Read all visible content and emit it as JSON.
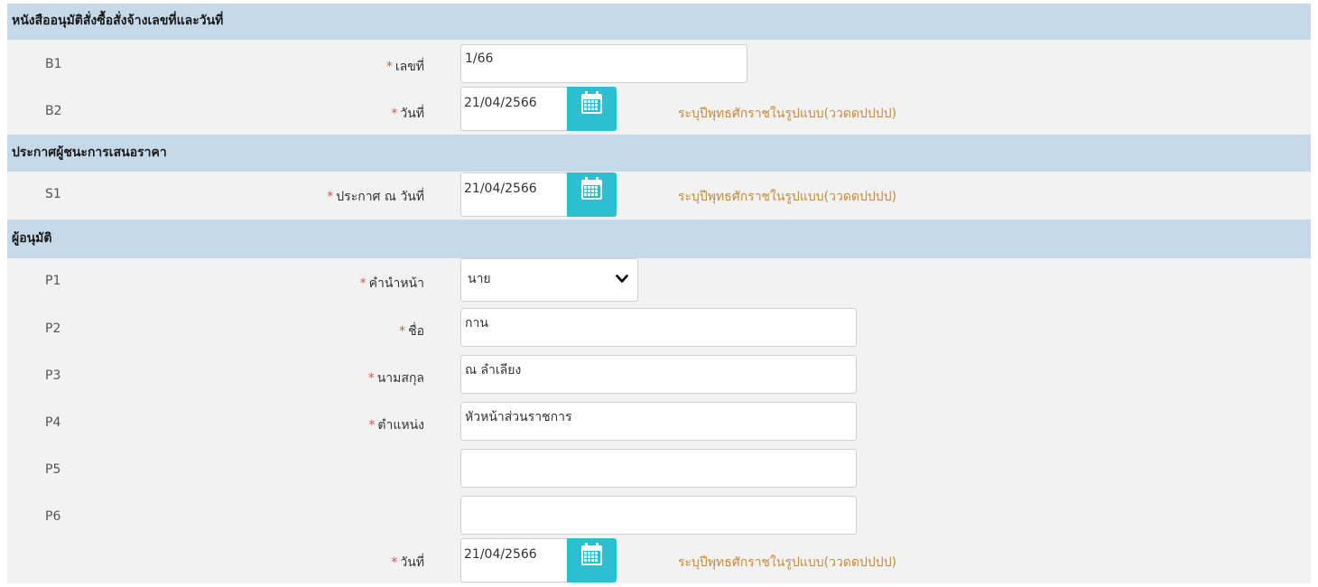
{
  "sections": {
    "approval": "หนังสืออนุมัติสั่งซื้อสั่งจ้างเลขที่และวันที่",
    "announcement": "ประกาศผู้ชนะการเสนอราคา",
    "approver": "ผู้อนุมัติ"
  },
  "required_mark": "*",
  "date_hint": "ระบุปีพุทธศักราชในรูปแบบ(ววดดปปปป)",
  "rows": {
    "b1": {
      "code": "B1",
      "label": "เลขที่",
      "value": "1/66"
    },
    "b2": {
      "code": "B2",
      "label": "วันที่",
      "value": "21/04/2566"
    },
    "s1": {
      "code": "S1",
      "label": "ประกาศ ณ วันที่",
      "value": "21/04/2566"
    },
    "p1": {
      "code": "P1",
      "label": "คำนำหน้า",
      "value": "นาย"
    },
    "p2": {
      "code": "P2",
      "label": "ชื่อ",
      "value": "กาน"
    },
    "p3": {
      "code": "P3",
      "label": "นามสกุล",
      "value": "ณ ลำเลียง"
    },
    "p4": {
      "code": "P4",
      "label": "ตำแหน่ง",
      "value": "หัวหน้าส่วนราชการ"
    },
    "p5": {
      "code": "P5",
      "value": ""
    },
    "p6": {
      "code": "P6",
      "value": ""
    },
    "approve_date": {
      "label": "วันที่",
      "value": "21/04/2566"
    }
  },
  "colors": {
    "section_bg": "#c5d9e8",
    "panel_bg": "#f2f2f2",
    "calendar_button": "#2bbfd1",
    "hint_text": "#c98a3a",
    "required": "#e05050"
  },
  "icons": {
    "calendar": "calendar-icon",
    "dropdown": "chevron-down-icon"
  }
}
